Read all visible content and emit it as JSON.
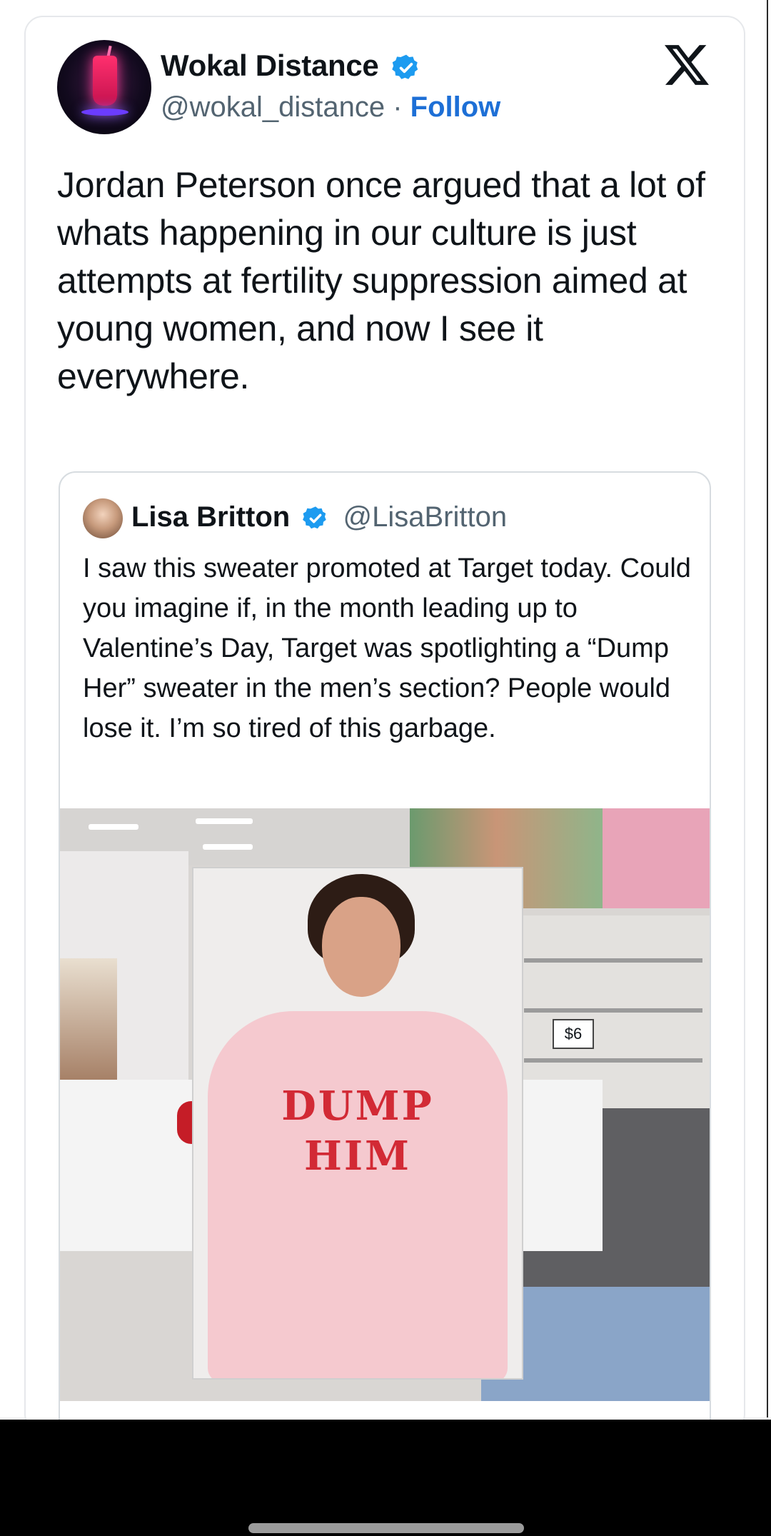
{
  "tweet": {
    "author_name": "Wokal Distance",
    "handle": "@wokal_distance",
    "separator": " · ",
    "follow_label": "Follow",
    "text": "Jordan Peterson once argued that a lot of whats happening in our culture is just attempts at fertility suppression aimed at young women, and now I see it everywhere."
  },
  "quoted_tweet": {
    "author_name": "Lisa Britton",
    "handle": "@LisaBritton",
    "text": "I saw this sweater promoted at Target today. Could you imagine if, in the month leading up to Valentine’s Day, Target was spotlighting a “Dump Her” sweater in the men’s section? People would lose it. I’m so tired of this garbage."
  },
  "photo": {
    "sweater_line1": "DUMP",
    "sweater_line2": "HIM",
    "price_tag": "$6"
  },
  "colors": {
    "link": "#1d6fd6",
    "verified": "#1d9bf0",
    "secondary_text": "#536471"
  },
  "icons": {
    "verified": "verified-badge-icon",
    "logo": "x-logo-icon"
  }
}
